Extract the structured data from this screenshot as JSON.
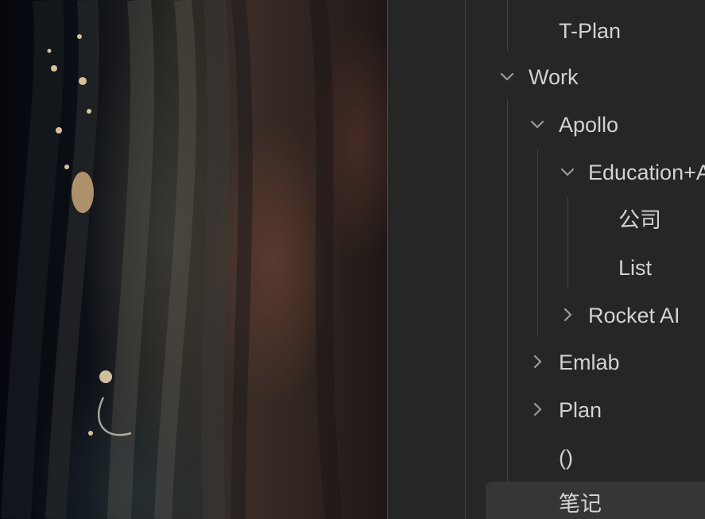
{
  "tree": {
    "items": [
      {
        "label": "T-Plan",
        "expanded": null
      },
      {
        "label": "Work",
        "expanded": true
      },
      {
        "label": "Apollo",
        "expanded": true
      },
      {
        "label": "Education+A",
        "expanded": true
      },
      {
        "label": "公司",
        "expanded": null
      },
      {
        "label": "List",
        "expanded": null
      },
      {
        "label": "Rocket AI",
        "expanded": false
      },
      {
        "label": "Emlab",
        "expanded": false
      },
      {
        "label": "Plan",
        "expanded": false
      },
      {
        "label": "()",
        "expanded": null
      },
      {
        "label": "笔记",
        "expanded": null,
        "selected": true
      }
    ]
  },
  "icons": {
    "expanded": "chevron-down-icon",
    "collapsed": "chevron-right-icon"
  },
  "colors": {
    "panel_bg": "#262626",
    "text": "#d2d2d2",
    "chevron": "#9a9a9a",
    "guide": "#444444",
    "selected_bg": "#363636"
  }
}
